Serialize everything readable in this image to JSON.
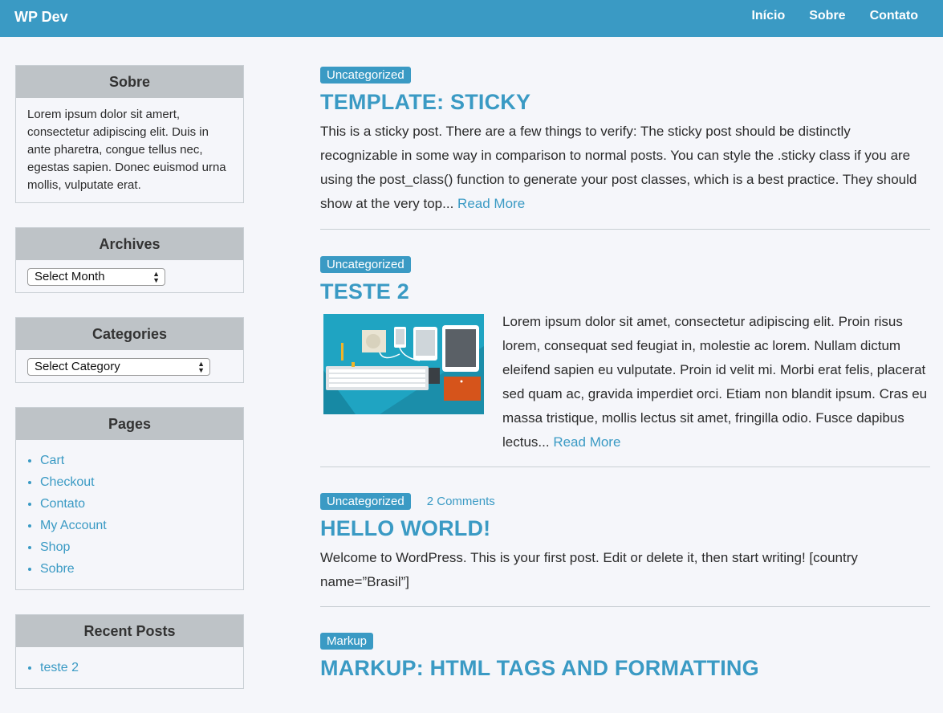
{
  "header": {
    "brand": "WP Dev",
    "nav": [
      "Início",
      "Sobre",
      "Contato"
    ]
  },
  "sidebar": {
    "sobre": {
      "title": "Sobre",
      "text": "Lorem ipsum dolor sit amert, consectetur adipiscing elit. Duis in ante pharetra, congue tellus nec, egestas sapien. Donec euismod urna mollis, vulputate erat."
    },
    "archives": {
      "title": "Archives",
      "select": "Select Month"
    },
    "categories": {
      "title": "Categories",
      "select": "Select Category"
    },
    "pages": {
      "title": "Pages",
      "items": [
        "Cart",
        "Checkout",
        "Contato",
        "My Account",
        "Shop",
        "Sobre"
      ]
    },
    "recent_posts": {
      "title": "Recent Posts",
      "items": [
        "teste 2"
      ]
    }
  },
  "posts": [
    {
      "category": "Uncategorized",
      "title": "TEMPLATE: STICKY",
      "excerpt": "This is a sticky post. There are a few things to verify: The sticky post should be distinctly recognizable in some way in comparison to normal posts. You can style the .sticky class if you are using the post_class() function to generate your post classes, which is a best practice. They should show at the very top...",
      "read_more": "Read More"
    },
    {
      "category": "Uncategorized",
      "title": "TESTE 2",
      "excerpt": "Lorem ipsum dolor sit amet, consectetur adipiscing elit. Proin risus lorem, consequat sed feugiat in, molestie ac lorem. Nullam dictum eleifend sapien eu vulputate. Proin id velit mi. Morbi erat felis, placerat sed quam ac, gravida imperdiet orci. Etiam non blandit ipsum. Cras eu massa tristique, mollis lectus sit amet, fringilla odio. Fusce dapibus lectus...",
      "read_more": "Read More"
    },
    {
      "category": "Uncategorized",
      "comments": "2 Comments",
      "title": "HELLO WORLD!",
      "excerpt": "Welcome to WordPress. This is your first post. Edit or delete it, then start writing! [country name=”Brasil”]"
    },
    {
      "category": "Markup",
      "title": "MARKUP: HTML TAGS AND FORMATTING"
    }
  ],
  "colors": {
    "accent": "#3a9ac4",
    "widget_header": "#bec3c7",
    "background": "#f5f6fa"
  }
}
